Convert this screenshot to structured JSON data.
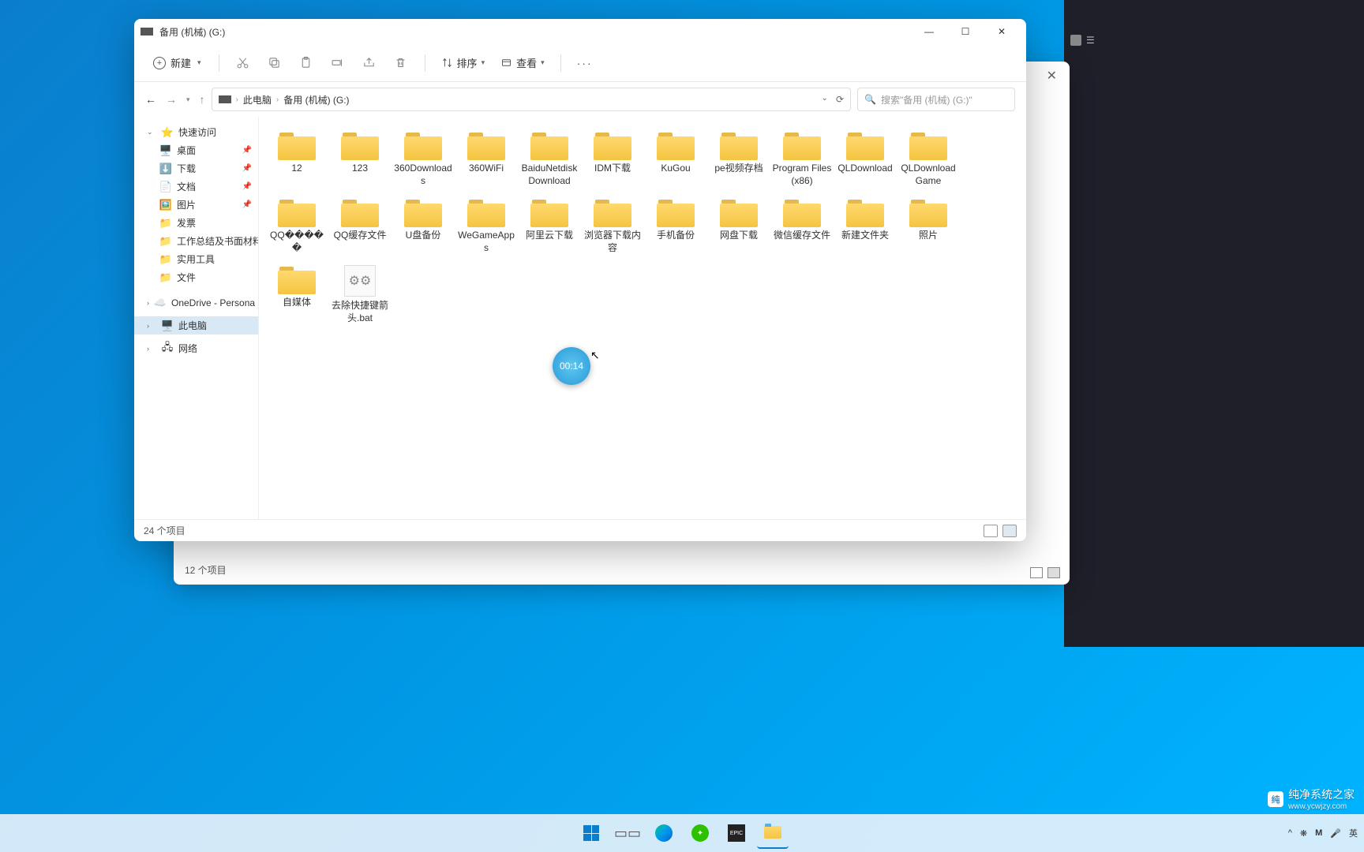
{
  "window": {
    "title": "备用 (机械)  (G:)",
    "status": "24 个项目"
  },
  "window_back": {
    "status": "12 个项目"
  },
  "toolbar": {
    "new_label": "新建",
    "sort_label": "排序",
    "view_label": "查看"
  },
  "breadcrumb": {
    "root": "此电脑",
    "folder": "备用 (机械)  (G:)"
  },
  "search": {
    "placeholder": "搜索\"备用 (机械)  (G:)\""
  },
  "sidebar": {
    "quick_access": "快速访问",
    "items": [
      {
        "label": "桌面",
        "icon": "🖥️",
        "pinned": true
      },
      {
        "label": "下载",
        "icon": "⬇️",
        "pinned": true
      },
      {
        "label": "文档",
        "icon": "📄",
        "pinned": true
      },
      {
        "label": "图片",
        "icon": "🖼️",
        "pinned": true
      },
      {
        "label": "发票",
        "icon": "📁",
        "pinned": false
      },
      {
        "label": "工作总结及书面材料",
        "icon": "📁",
        "pinned": false
      },
      {
        "label": "实用工具",
        "icon": "📁",
        "pinned": false
      },
      {
        "label": "文件",
        "icon": "📁",
        "pinned": false
      }
    ],
    "onedrive": "OneDrive - Persona",
    "this_pc": "此电脑",
    "network": "网络"
  },
  "folders": [
    {
      "name": "12",
      "type": "folder"
    },
    {
      "name": "123",
      "type": "folder"
    },
    {
      "name": "360Downloads",
      "type": "folder"
    },
    {
      "name": "360WiFi",
      "type": "folder"
    },
    {
      "name": "BaiduNetdiskDownload",
      "type": "folder"
    },
    {
      "name": "IDM下载",
      "type": "folder"
    },
    {
      "name": "KuGou",
      "type": "folder"
    },
    {
      "name": "pe视频存档",
      "type": "folder"
    },
    {
      "name": "Program Files (x86)",
      "type": "folder"
    },
    {
      "name": "QLDownload",
      "type": "folder"
    },
    {
      "name": "QLDownloadGame",
      "type": "folder"
    },
    {
      "name": "QQ�����",
      "type": "folder"
    },
    {
      "name": "QQ缓存文件",
      "type": "folder"
    },
    {
      "name": "U盘备份",
      "type": "folder"
    },
    {
      "name": "WeGameApps",
      "type": "folder"
    },
    {
      "name": "阿里云下载",
      "type": "folder"
    },
    {
      "name": "浏览器下载内容",
      "type": "folder"
    },
    {
      "name": "手机备份",
      "type": "folder"
    },
    {
      "name": "网盘下载",
      "type": "folder"
    },
    {
      "name": "微信缓存文件",
      "type": "folder"
    },
    {
      "name": "新建文件夹",
      "type": "folder"
    },
    {
      "name": "照片",
      "type": "folder"
    },
    {
      "name": "自媒体",
      "type": "folder"
    },
    {
      "name": "去除快捷键箭头.bat",
      "type": "bat"
    }
  ],
  "timer": "00:14",
  "taskbar": {
    "ime": "英"
  },
  "watermark": {
    "text": "纯净系统之家",
    "url": "www.ycwjzy.com"
  }
}
